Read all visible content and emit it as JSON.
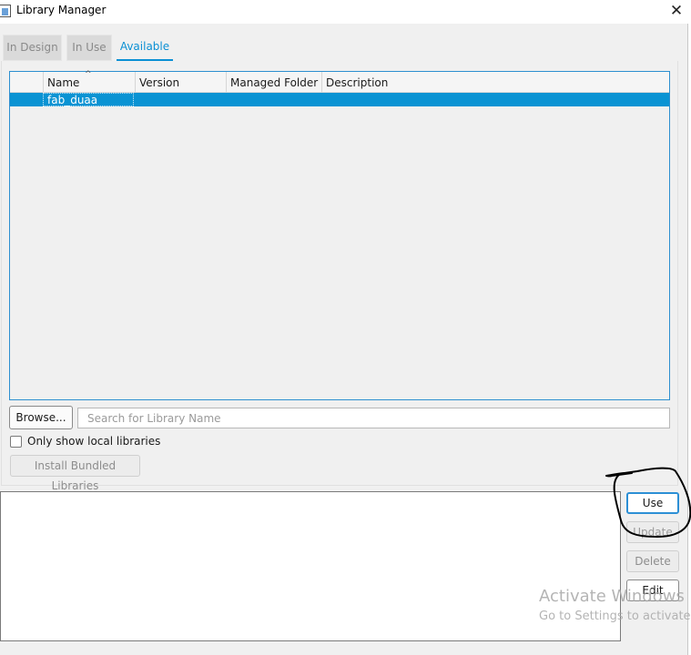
{
  "window": {
    "title": "Library Manager",
    "close_glyph": "✕"
  },
  "tabs": [
    {
      "label": "In Design",
      "active": false
    },
    {
      "label": "In Use",
      "active": false
    },
    {
      "label": "Available",
      "active": true
    }
  ],
  "table": {
    "sort_indicator": "^",
    "columns": [
      "Name",
      "Version",
      "Managed Folder",
      "Description"
    ],
    "rows": [
      {
        "name": "fab_duaa",
        "version": "",
        "managed_folder": "",
        "description": "",
        "selected": true
      }
    ]
  },
  "controls": {
    "browse_label": "Browse...",
    "search_placeholder": "Search for Library Name",
    "search_value": "",
    "local_only_label": "Only show local libraries",
    "local_only_checked": false,
    "install_bundled_label": "Install Bundled Libraries"
  },
  "actions": {
    "use_label": "Use",
    "update_label": "Update",
    "delete_label": "Delete",
    "edit_label": "Edit"
  },
  "watermark": {
    "title": "Activate Windows",
    "subtitle": "Go to Settings to activate"
  },
  "colors": {
    "accent": "#0b90d4",
    "selection": "#0a93d3",
    "annotation_ink": "#000000"
  }
}
